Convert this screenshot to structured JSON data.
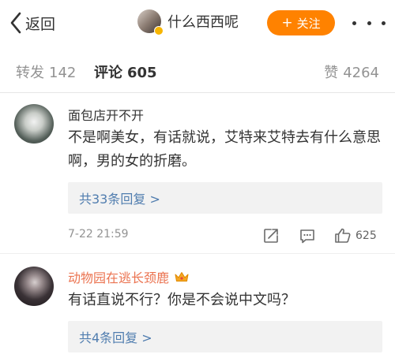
{
  "nav": {
    "back_label": "返回",
    "author_name": "什么西西呢",
    "follow_label": "关注"
  },
  "tabs": [
    {
      "label": "转发",
      "count": "142"
    },
    {
      "label": "评论",
      "count": "605"
    },
    {
      "label": "赞",
      "count": "4264"
    }
  ],
  "comments": [
    {
      "user": "面包店开不开",
      "text": "不是啊美女，有话就说，艾特来艾特去有什么意思啊，男的女的折磨。",
      "replies": "共33条回复 >",
      "time": "7-22 21:59",
      "likes": "625"
    },
    {
      "user": "动物园在逃长颈鹿",
      "text": "有话直说不行？你是不会说中文吗？",
      "replies": "共4条回复 >"
    }
  ],
  "colors": {
    "accent": "#ff8200",
    "vip_name": "#eb7350",
    "link": "#507daf",
    "muted": "#939393"
  },
  "icons": {
    "back": "chevron-left-icon",
    "more": "more-dots-icon",
    "verified": "verified-badge-icon",
    "crown": "crown-icon",
    "share": "share-icon",
    "reply": "comment-icon",
    "like": "thumbs-up-icon"
  }
}
